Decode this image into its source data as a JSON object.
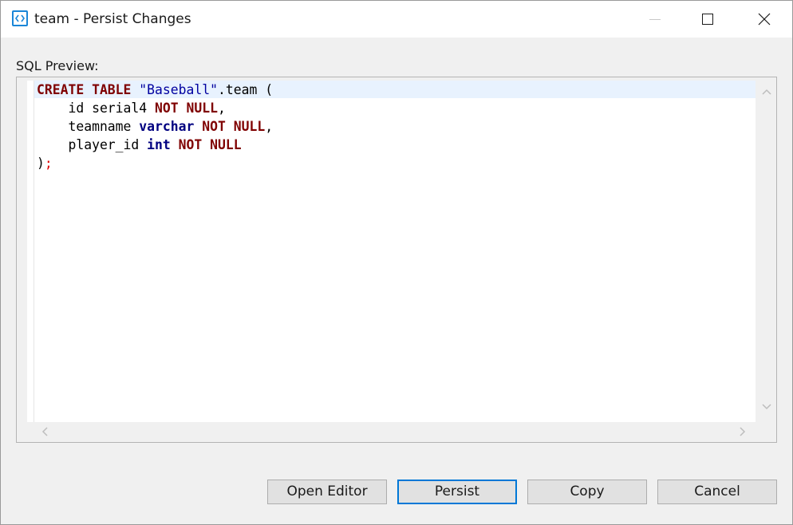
{
  "window": {
    "title": "team - Persist Changes",
    "icon": "code-brackets-icon"
  },
  "editor": {
    "label": "SQL Preview:",
    "code_lines": [
      [
        {
          "t": "CREATE TABLE",
          "c": "kw"
        },
        {
          "t": " "
        },
        {
          "t": "\"Baseball\"",
          "c": "str"
        },
        {
          "t": ".team ("
        }
      ],
      [
        {
          "t": "    id serial4 "
        },
        {
          "t": "NOT NULL",
          "c": "kw"
        },
        {
          "t": ","
        }
      ],
      [
        {
          "t": "    teamname "
        },
        {
          "t": "varchar",
          "c": "ty"
        },
        {
          "t": " "
        },
        {
          "t": "NOT NULL",
          "c": "kw"
        },
        {
          "t": ","
        }
      ],
      [
        {
          "t": "    player_id "
        },
        {
          "t": "int",
          "c": "ty"
        },
        {
          "t": " "
        },
        {
          "t": "NOT NULL",
          "c": "kw"
        }
      ],
      [
        {
          "t": ")"
        },
        {
          "t": ";",
          "c": "red"
        }
      ]
    ]
  },
  "buttons": {
    "open_editor": "Open Editor",
    "persist": "Persist",
    "copy": "Copy",
    "cancel": "Cancel"
  },
  "colors": {
    "keyword": "#7f0000",
    "type": "#000080",
    "string": "#0000a0",
    "accent": "#0078d7",
    "current_line": "#e8f2fe"
  }
}
